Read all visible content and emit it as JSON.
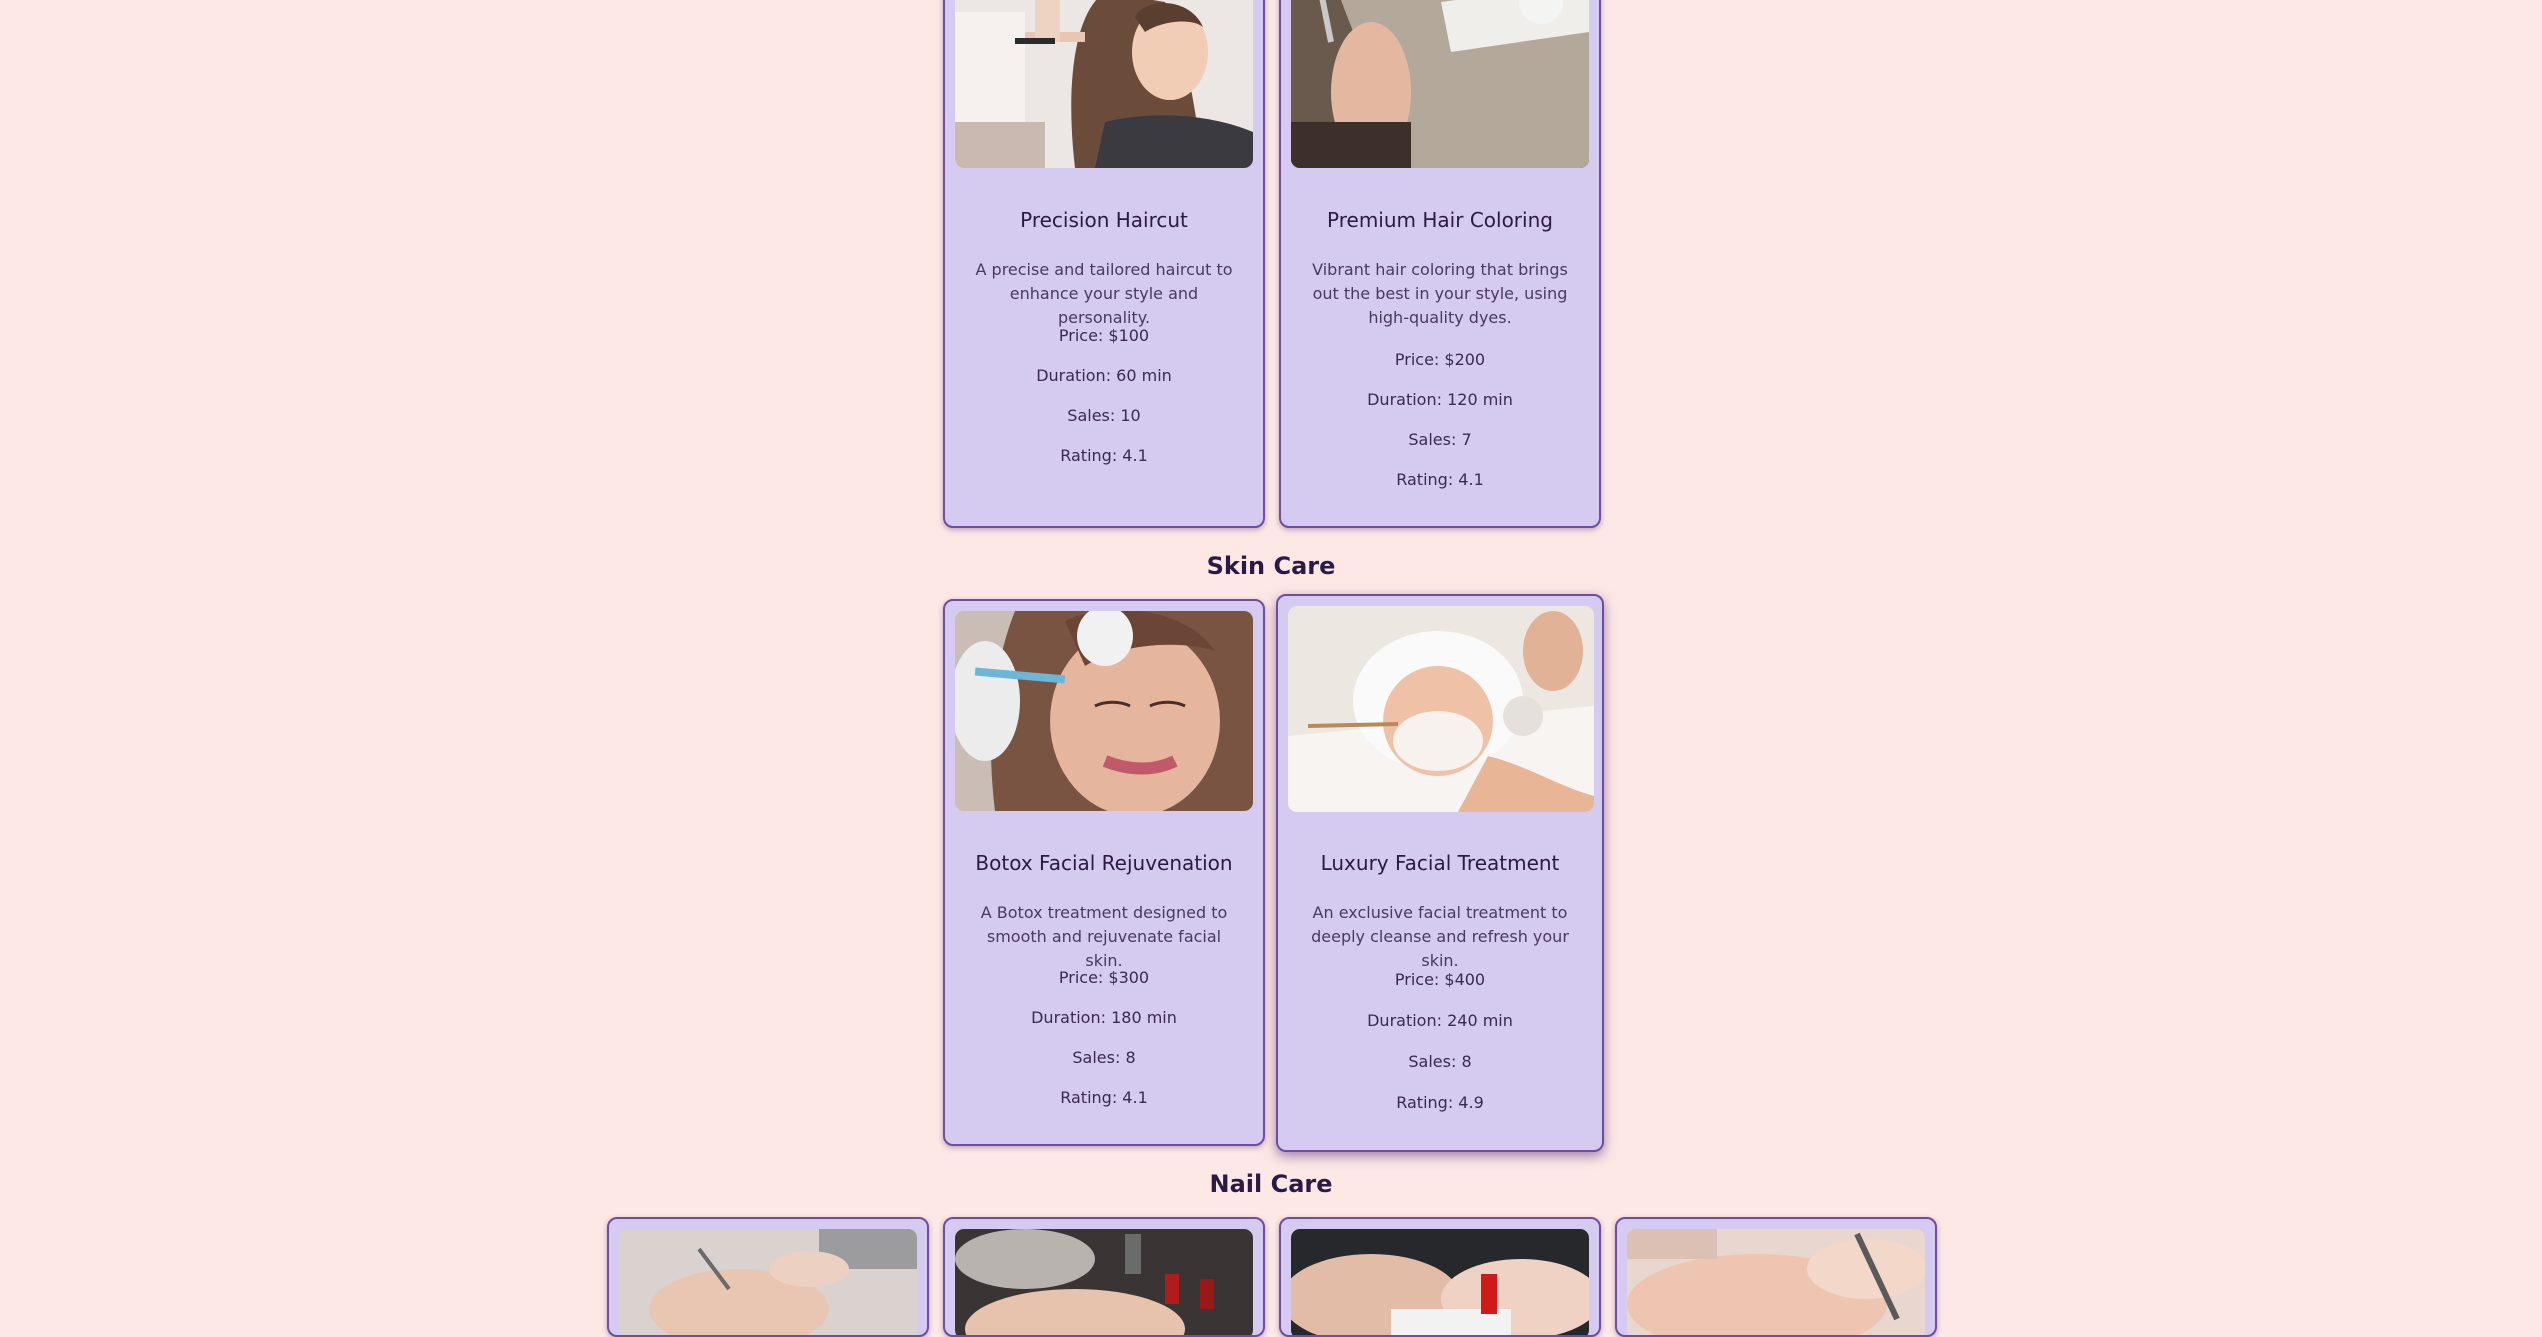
{
  "sections": {
    "skin_care_heading": "Skin Care",
    "nail_care_heading": "Nail Care"
  },
  "hair": [
    {
      "title": "Precision Haircut",
      "description": "A precise and tailored haircut to enhance your style and personality.",
      "price": "Price: $100",
      "duration": "Duration: 60 min",
      "sales": "Sales: 10",
      "rating": "Rating: 4.1"
    },
    {
      "title": "Premium Hair Coloring",
      "description": "Vibrant hair coloring that brings out the best in your style, using high-quality dyes.",
      "price": "Price: $200",
      "duration": "Duration: 120 min",
      "sales": "Sales: 7",
      "rating": "Rating: 4.1"
    }
  ],
  "skin": [
    {
      "title": "Botox Facial Rejuvenation",
      "description": "A Botox treatment designed to smooth and rejuvenate facial skin.",
      "price": "Price: $300",
      "duration": "Duration: 180 min",
      "sales": "Sales: 8",
      "rating": "Rating: 4.1"
    },
    {
      "title": "Luxury Facial Treatment",
      "description": "An exclusive facial treatment to deeply cleanse and refresh your skin.",
      "price": "Price: $400",
      "duration": "Duration: 240 min",
      "sales": "Sales: 8",
      "rating": "Rating: 4.9"
    }
  ],
  "colors": {
    "background": "#fde8e6",
    "card": "#d5caf0",
    "card_border": "#6e4ea0",
    "heading": "#2a1a45"
  }
}
